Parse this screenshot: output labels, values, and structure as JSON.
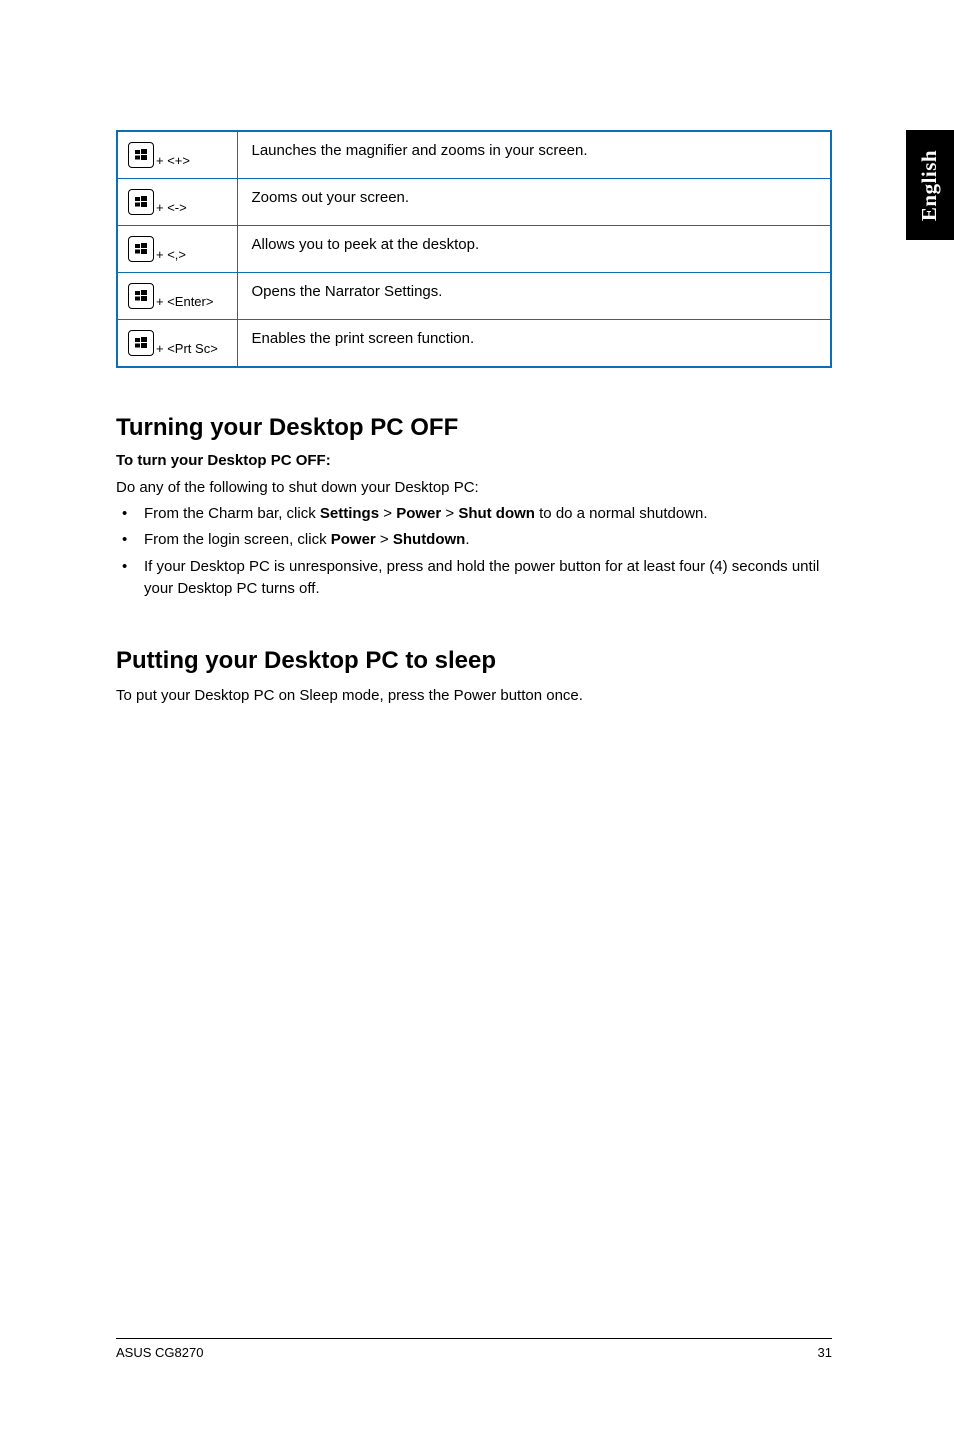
{
  "side_tab": "English",
  "table": {
    "rows": [
      {
        "key_suffix": "+ <+>",
        "desc": "Launches the magnifier and zooms in your screen."
      },
      {
        "key_suffix": "+ <->",
        "desc": "Zooms out your screen."
      },
      {
        "key_suffix": "+ <,>",
        "desc": "Allows you to peek at the desktop."
      },
      {
        "key_suffix": "+ <Enter>",
        "desc": "Opens the Narrator Settings."
      },
      {
        "key_suffix": "+ <Prt Sc>",
        "desc": "Enables the print screen function."
      }
    ]
  },
  "section_off": {
    "heading": "Turning your Desktop PC OFF",
    "sub": "To turn your Desktop PC OFF:",
    "intro": "Do any of the following to shut down your Desktop PC:",
    "bullets": [
      "From the Charm bar, click <b>Settings</b> > <b>Power</b> > <b>Shut down</b> to do a normal shutdown.",
      "From the login screen, click <b>Power</b> > <b>Shutdown</b>.",
      "If your Desktop PC is unresponsive, press and hold the power  button for at least four (4) seconds until your Desktop PC turns off."
    ]
  },
  "section_sleep": {
    "heading": "Putting your Desktop PC to sleep",
    "body": "To put your Desktop PC on Sleep mode, press the Power button once."
  },
  "footer": {
    "left": "ASUS CG8270",
    "right": "31"
  }
}
